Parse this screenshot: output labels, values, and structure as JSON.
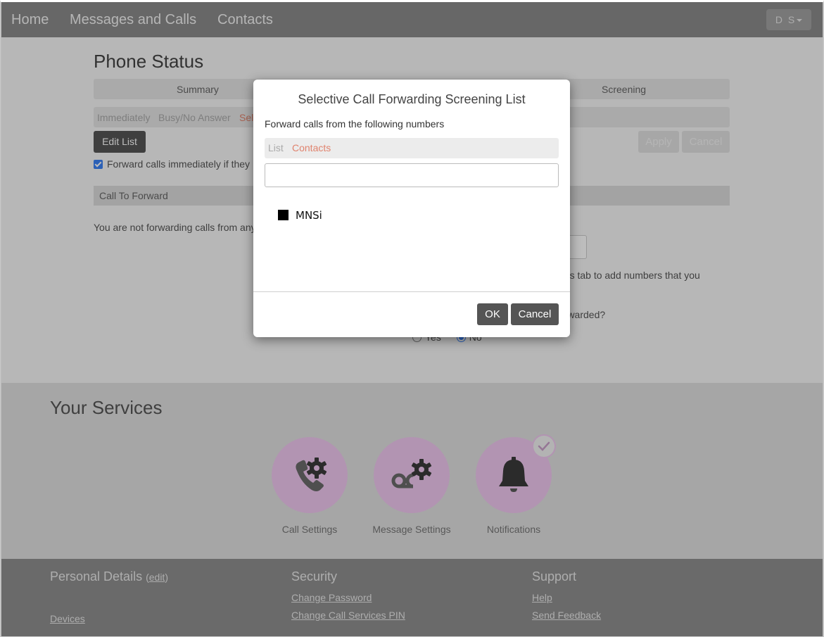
{
  "nav": {
    "items": [
      {
        "label": "Home"
      },
      {
        "label": "Messages and Calls"
      },
      {
        "label": "Contacts"
      }
    ],
    "user_initials": "D S"
  },
  "phone_status": {
    "title": "Phone Status",
    "tabs": [
      {
        "label": "Summary"
      },
      {
        "label": "Screening"
      }
    ],
    "subtabs": [
      {
        "label": "Immediately",
        "active": false
      },
      {
        "label": "Busy/No Answer",
        "active": false
      },
      {
        "label": "Sel",
        "active": true
      }
    ],
    "edit_list_label": "Edit List",
    "apply_label": "Apply",
    "cancel_label": "Cancel",
    "checkbox_label": "Forward calls immediately if they",
    "checkbox_checked": true,
    "section_header": "Call To Forward",
    "not_forwarding_text": "You are not forwarding calls from any",
    "options_tab_text": "ons tab to add numbers that you",
    "forwarded_question": "orwarded?",
    "radio_options": [
      {
        "label": "Yes",
        "checked": false
      },
      {
        "label": "No",
        "checked": true
      }
    ]
  },
  "services": {
    "title": "Your Services",
    "items": [
      {
        "label": "Call Settings",
        "icon": "phone-gear-icon"
      },
      {
        "label": "Message Settings",
        "icon": "voicemail-gear-icon"
      },
      {
        "label": "Notifications",
        "icon": "bell-icon",
        "badge": "check"
      }
    ]
  },
  "footer": {
    "personal_details": "Personal Details",
    "edit_label": "edit",
    "devices": "Devices",
    "security": "Security",
    "change_password": "Change Password",
    "change_pin": "Change Call Services PIN",
    "support": "Support",
    "help": "Help",
    "send_feedback": "Send Feedback"
  },
  "modal": {
    "title": "Selective Call Forwarding Screening List",
    "subtitle": "Forward calls from the following numbers",
    "tabs": [
      {
        "label": "List",
        "active": false
      },
      {
        "label": "Contacts",
        "active": true
      }
    ],
    "search_value": "",
    "search_placeholder": "",
    "items": [
      {
        "label": "MNSi",
        "checked": true
      }
    ],
    "ok_label": "OK",
    "cancel_label": "Cancel"
  },
  "colors": {
    "accent_orange": "#e0836e",
    "checkbox_blue": "#3b82f6",
    "service_circle": "#f0c8f0",
    "button_dark": "#555555"
  }
}
